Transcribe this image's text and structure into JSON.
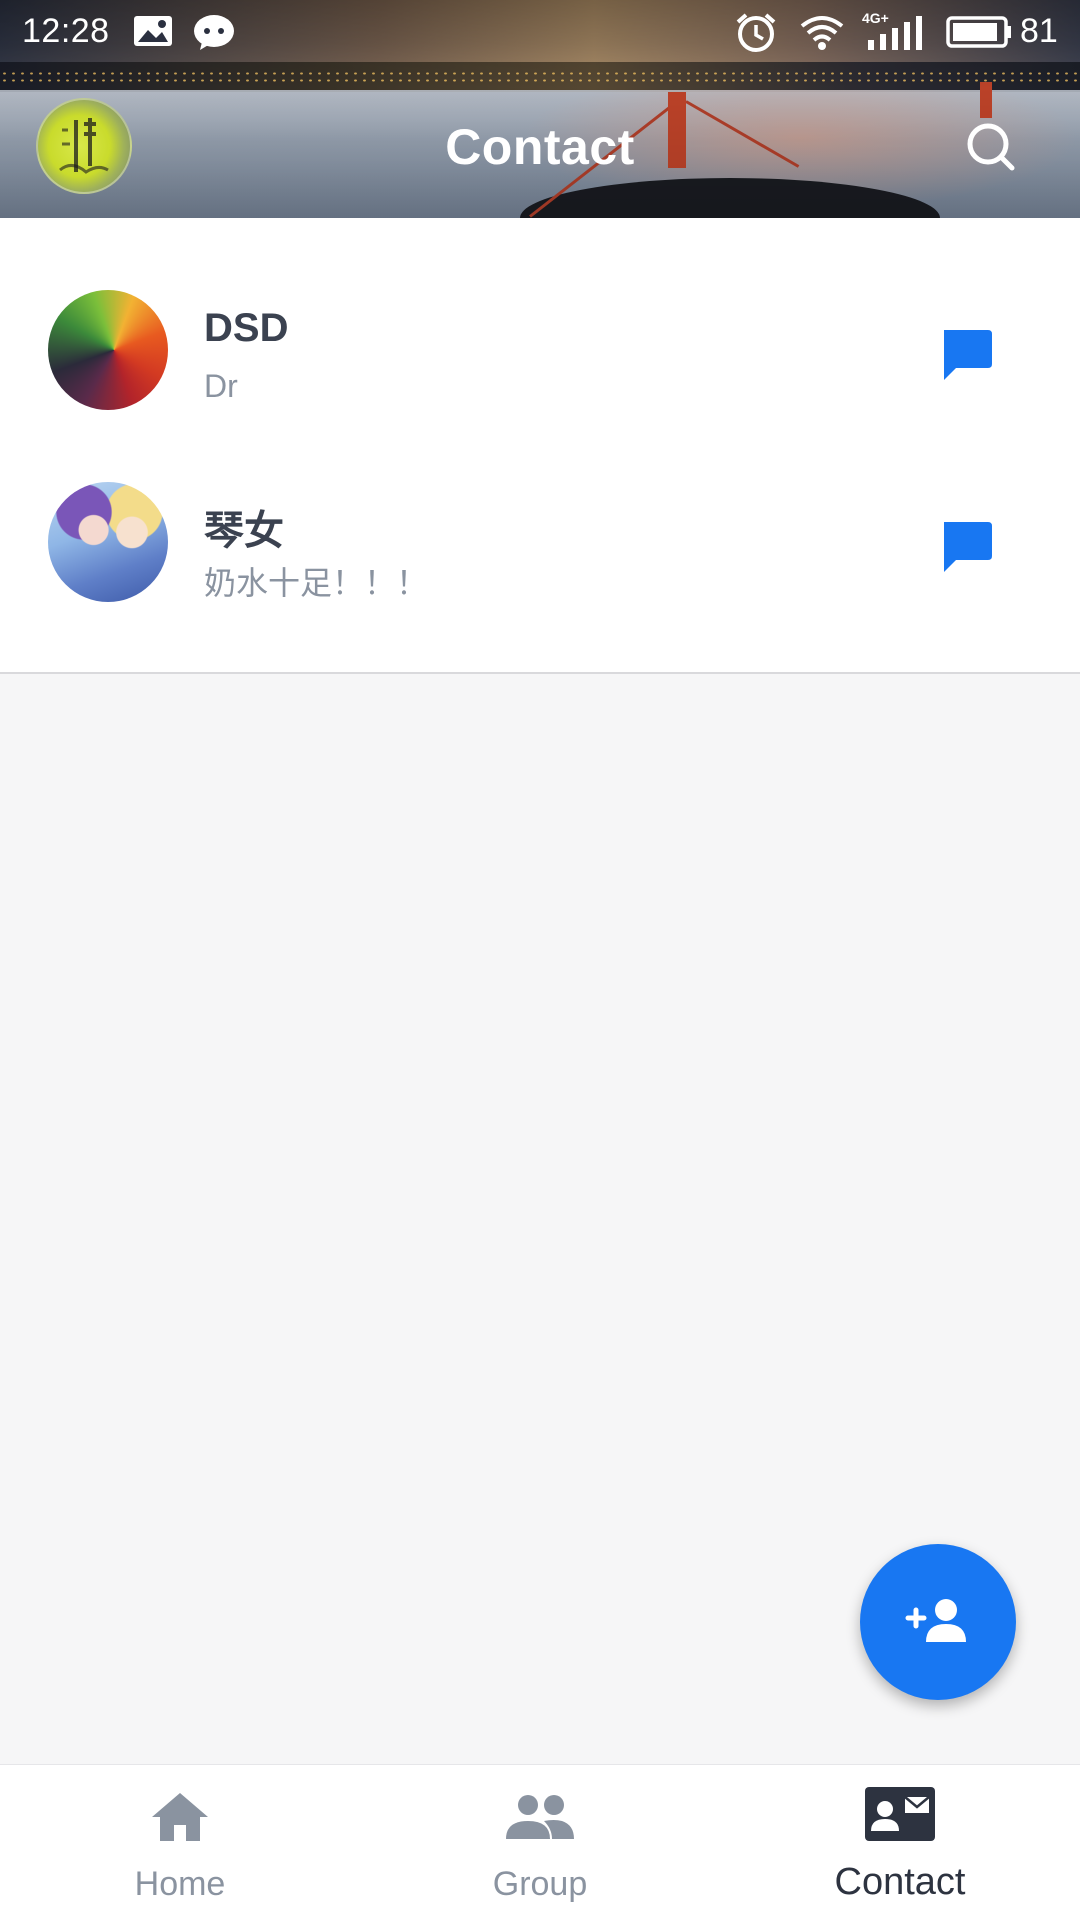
{
  "status_bar": {
    "time": "12:28",
    "network": "4G+",
    "battery": "81",
    "icons": [
      "gallery-icon",
      "wechat-icon",
      "alarm-icon",
      "wifi-icon",
      "signal-icon",
      "battery-icon"
    ]
  },
  "app_bar": {
    "title": "Contact",
    "avatar_icon": "profile-avatar",
    "search_icon": "search-icon"
  },
  "contacts": [
    {
      "name": "DSD",
      "subtitle": "Dr",
      "action_icon": "message-icon"
    },
    {
      "name": "琴女",
      "subtitle": "奶水十足！！！",
      "action_icon": "message-icon"
    }
  ],
  "fab": {
    "icon": "add-person-icon"
  },
  "bottom_nav": {
    "items": [
      {
        "label": "Home",
        "icon": "home-icon",
        "active": false
      },
      {
        "label": "Group",
        "icon": "group-icon",
        "active": false
      },
      {
        "label": "Contact",
        "icon": "contact-card-icon",
        "active": true
      }
    ]
  },
  "colors": {
    "accent": "#1877f2",
    "name_text": "#3b4250",
    "subtitle_text": "#8a93a0",
    "background": "#f6f6f7"
  }
}
